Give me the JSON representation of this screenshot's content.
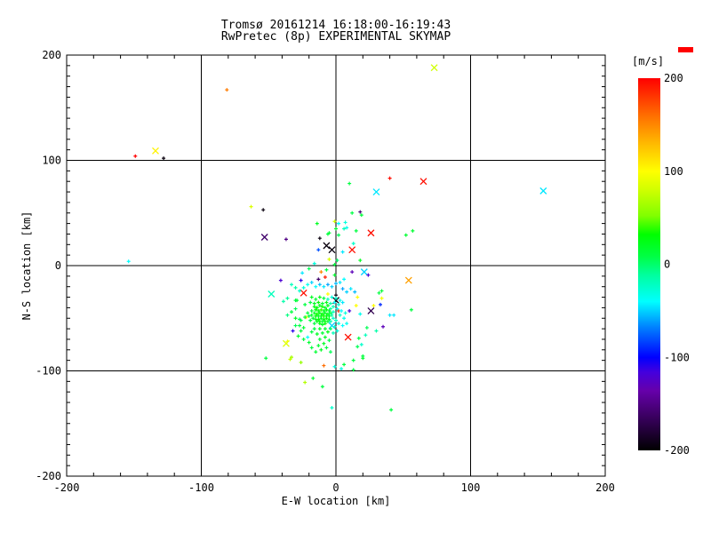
{
  "title": {
    "line1": "Tromsø 20161214 16:18:00-16:19:43",
    "line2": "RwPretec (8p) EXPERIMENTAL SKYMAP"
  },
  "colorbar": {
    "label": "[m/s]",
    "ticks": [
      200,
      100,
      0,
      -100,
      -200
    ],
    "min": -200,
    "max": 200,
    "stops": [
      [
        0.0,
        "#000000"
      ],
      [
        0.1,
        "#40006a"
      ],
      [
        0.16,
        "#6600aa"
      ],
      [
        0.21,
        "#4400dd"
      ],
      [
        0.25,
        "#0000ff"
      ],
      [
        0.33,
        "#0080ff"
      ],
      [
        0.4,
        "#00ffff"
      ],
      [
        0.47,
        "#00ffa0"
      ],
      [
        0.52,
        "#00ff46"
      ],
      [
        0.58,
        "#00ff00"
      ],
      [
        0.63,
        "#80ff00"
      ],
      [
        0.7,
        "#d0ff00"
      ],
      [
        0.75,
        "#ffff00"
      ],
      [
        0.83,
        "#ffb400"
      ],
      [
        0.9,
        "#ff6e00"
      ],
      [
        1.0,
        "#ff0000"
      ]
    ]
  },
  "chart_data": {
    "type": "scatter",
    "xlabel": "E-W location [km]",
    "ylabel": "N-S location [km]",
    "xlim": [
      -200,
      200
    ],
    "ylim": [
      -200,
      200
    ],
    "grid": true,
    "axes": {
      "x": {
        "major_ticks": [
          -200,
          -100,
          0,
          100,
          200
        ],
        "minor_step": 20,
        "gridlines": [
          -100,
          0,
          100
        ]
      },
      "y": {
        "major_ticks": [
          -200,
          -100,
          0,
          100,
          200
        ],
        "minor_step": 10,
        "gridlines": [
          -100,
          0,
          100
        ]
      }
    },
    "value_label": "[m/s]",
    "symbols": {
      "d": "small-plus",
      "x": "cross"
    },
    "points": [
      [
        -81,
        167,
        155,
        "d"
      ],
      [
        73,
        188,
        80,
        "x"
      ],
      [
        -149,
        104,
        200,
        "d"
      ],
      [
        -134,
        109,
        105,
        "x"
      ],
      [
        -128,
        102,
        -195,
        "d"
      ],
      [
        -154,
        4,
        -40,
        "d"
      ],
      [
        154,
        71,
        -45,
        "x"
      ],
      [
        65,
        80,
        195,
        "x"
      ],
      [
        30,
        70,
        -45,
        "x"
      ],
      [
        40,
        83,
        195,
        "d"
      ],
      [
        10,
        78,
        10,
        "d"
      ],
      [
        -63,
        56,
        85,
        "d"
      ],
      [
        -54,
        53,
        -195,
        "d"
      ],
      [
        -53,
        27,
        -160,
        "x"
      ],
      [
        -37,
        25,
        -150,
        "d"
      ],
      [
        26,
        31,
        195,
        "x"
      ],
      [
        52,
        29,
        15,
        "d"
      ],
      [
        57,
        33,
        15,
        "d"
      ],
      [
        12,
        50,
        8,
        "d"
      ],
      [
        18,
        51,
        -155,
        "d"
      ],
      [
        19,
        48,
        12,
        "d"
      ],
      [
        -1,
        42,
        80,
        "d"
      ],
      [
        2,
        40,
        -40,
        "d"
      ],
      [
        7,
        41,
        -30,
        "d"
      ],
      [
        8,
        36,
        -35,
        "d"
      ],
      [
        0,
        35,
        15,
        "d"
      ],
      [
        -14,
        40,
        20,
        "d"
      ],
      [
        -6,
        30,
        10,
        "d"
      ],
      [
        2,
        29,
        5,
        "d"
      ],
      [
        15,
        33,
        10,
        "d"
      ],
      [
        13,
        21,
        -25,
        "d"
      ],
      [
        5,
        13,
        -45,
        "d"
      ],
      [
        -13,
        15,
        -80,
        "d"
      ],
      [
        -5,
        6,
        85,
        "d"
      ],
      [
        1,
        5,
        0,
        "d"
      ],
      [
        -1,
        1,
        10,
        "d"
      ],
      [
        18,
        5,
        20,
        "d"
      ],
      [
        12,
        15,
        195,
        "x"
      ],
      [
        -7,
        19,
        -195,
        "x"
      ],
      [
        -3,
        15,
        -195,
        "x"
      ],
      [
        -12,
        26,
        -195,
        "d"
      ],
      [
        -16,
        2,
        -30,
        "d"
      ],
      [
        -25,
        -7,
        -45,
        "d"
      ],
      [
        6,
        35,
        -20,
        "d"
      ],
      [
        -5,
        31,
        12,
        "d"
      ],
      [
        -11,
        -6,
        150,
        "d"
      ],
      [
        -8,
        -11,
        190,
        "d"
      ],
      [
        -7,
        -4,
        10,
        "d"
      ],
      [
        -1,
        -9,
        15,
        "d"
      ],
      [
        12,
        -6,
        -130,
        "d"
      ],
      [
        6,
        -13,
        -40,
        "d"
      ],
      [
        -13,
        -13,
        -160,
        "d"
      ],
      [
        21,
        -6,
        -50,
        "x"
      ],
      [
        24,
        -9,
        -120,
        "d"
      ],
      [
        -20,
        -3,
        5,
        "d"
      ],
      [
        -41,
        -14,
        -120,
        "d"
      ],
      [
        -26,
        -14,
        -110,
        "d"
      ],
      [
        -24,
        -26,
        195,
        "x"
      ],
      [
        -48,
        -27,
        -20,
        "x"
      ],
      [
        0,
        -33,
        -195,
        "x"
      ],
      [
        0,
        -28,
        -195,
        "d"
      ],
      [
        26,
        -43,
        -170,
        "x"
      ],
      [
        9,
        -68,
        195,
        "x"
      ],
      [
        -37,
        -74,
        85,
        "x"
      ],
      [
        -3,
        -57,
        -50,
        "x"
      ],
      [
        54,
        -14,
        140,
        "x"
      ],
      [
        16,
        -30,
        100,
        "d"
      ],
      [
        15,
        -38,
        100,
        "d"
      ],
      [
        28,
        -38,
        100,
        "d"
      ],
      [
        34,
        -31,
        95,
        "d"
      ],
      [
        -6,
        -27,
        100,
        "d"
      ],
      [
        -22,
        -49,
        95,
        "d"
      ],
      [
        2,
        -43,
        185,
        "d"
      ],
      [
        10,
        -43,
        -120,
        "d"
      ],
      [
        32,
        -26,
        10,
        "d"
      ],
      [
        34,
        -24,
        12,
        "d"
      ],
      [
        40,
        -47,
        -45,
        "d"
      ],
      [
        43,
        -47,
        -45,
        "d"
      ],
      [
        56,
        -42,
        10,
        "d"
      ],
      [
        18,
        -46,
        -35,
        "d"
      ],
      [
        30,
        -62,
        -15,
        "d"
      ],
      [
        23,
        -59,
        5,
        "d"
      ],
      [
        22,
        -66,
        -20,
        "d"
      ],
      [
        17,
        -69,
        10,
        "d"
      ],
      [
        19,
        -75,
        -25,
        "d"
      ],
      [
        16,
        -77,
        5,
        "d"
      ],
      [
        20,
        -86,
        10,
        "d"
      ],
      [
        35,
        -58,
        -130,
        "d"
      ],
      [
        33,
        -37,
        -90,
        "d"
      ],
      [
        -29,
        -33,
        15,
        "d"
      ],
      [
        -23,
        -37,
        10,
        "d"
      ],
      [
        -21,
        -45,
        12,
        "d"
      ],
      [
        -26,
        -52,
        8,
        "d"
      ],
      [
        -23,
        -49,
        15,
        "d"
      ],
      [
        -26,
        -62,
        10,
        "d"
      ],
      [
        -32,
        -62,
        -110,
        "d"
      ],
      [
        -21,
        -68,
        -40,
        "d"
      ],
      [
        -30,
        -50,
        18,
        "d"
      ],
      [
        -27,
        -51,
        5,
        "d"
      ],
      [
        -30,
        -33,
        10,
        "d"
      ],
      [
        -36,
        -72,
        95,
        "d"
      ],
      [
        -52,
        -88,
        10,
        "d"
      ],
      [
        -33,
        -87,
        65,
        "d"
      ],
      [
        -26,
        -92,
        60,
        "d"
      ],
      [
        -34,
        -89,
        75,
        "d"
      ],
      [
        -23,
        -111,
        70,
        "d"
      ],
      [
        -17,
        -107,
        15,
        "d"
      ],
      [
        -10,
        -115,
        10,
        "d"
      ],
      [
        -3,
        -135,
        -25,
        "d"
      ],
      [
        41,
        -137,
        10,
        "d"
      ],
      [
        -9,
        -95,
        160,
        "d"
      ],
      [
        -1,
        -96,
        -30,
        "d"
      ],
      [
        4,
        -98,
        -30,
        "d"
      ],
      [
        6,
        -94,
        10,
        "d"
      ],
      [
        13,
        -90,
        10,
        "d"
      ],
      [
        20,
        -88,
        15,
        "d"
      ],
      [
        13,
        -99,
        8,
        "d"
      ],
      [
        -16,
        -39,
        25,
        "d"
      ],
      [
        -14,
        -40,
        30,
        "d"
      ],
      [
        -12,
        -38,
        20,
        "d"
      ],
      [
        -10,
        -39,
        35,
        "d"
      ],
      [
        -8,
        -40,
        15,
        "d"
      ],
      [
        -6,
        -38,
        25,
        "d"
      ],
      [
        -15,
        -42,
        30,
        "d"
      ],
      [
        -13,
        -43,
        25,
        "d"
      ],
      [
        -11,
        -42,
        40,
        "d"
      ],
      [
        -9,
        -43,
        20,
        "d"
      ],
      [
        -7,
        -42,
        30,
        "d"
      ],
      [
        -5,
        -43,
        15,
        "d"
      ],
      [
        -16,
        -45,
        20,
        "d"
      ],
      [
        -14,
        -46,
        35,
        "d"
      ],
      [
        -12,
        -45,
        25,
        "d"
      ],
      [
        -10,
        -46,
        30,
        "d"
      ],
      [
        -8,
        -45,
        20,
        "d"
      ],
      [
        -6,
        -46,
        25,
        "d"
      ],
      [
        -4,
        -45,
        10,
        "d"
      ],
      [
        -15,
        -48,
        30,
        "d"
      ],
      [
        -13,
        -48,
        20,
        "d"
      ],
      [
        -11,
        -48,
        25,
        "d"
      ],
      [
        -9,
        -48,
        35,
        "d"
      ],
      [
        -7,
        -48,
        25,
        "d"
      ],
      [
        -5,
        -48,
        20,
        "d"
      ],
      [
        -17,
        -50,
        15,
        "d"
      ],
      [
        -15,
        -51,
        25,
        "d"
      ],
      [
        -13,
        -51,
        30,
        "d"
      ],
      [
        -11,
        -50,
        20,
        "d"
      ],
      [
        -9,
        -51,
        25,
        "d"
      ],
      [
        -7,
        -50,
        30,
        "d"
      ],
      [
        -5,
        -51,
        20,
        "d"
      ],
      [
        -14,
        -53,
        25,
        "d"
      ],
      [
        -12,
        -53,
        30,
        "d"
      ],
      [
        -10,
        -53,
        15,
        "d"
      ],
      [
        -8,
        -53,
        25,
        "d"
      ],
      [
        -6,
        -53,
        20,
        "d"
      ],
      [
        -16,
        -55,
        10,
        "d"
      ],
      [
        -12,
        -55,
        25,
        "d"
      ],
      [
        -10,
        -56,
        20,
        "d"
      ],
      [
        -8,
        -55,
        30,
        "d"
      ],
      [
        -18,
        -43,
        15,
        "d"
      ],
      [
        -18,
        -47,
        20,
        "d"
      ],
      [
        -3,
        -47,
        -15,
        "d"
      ],
      [
        -2,
        -44,
        -20,
        "d"
      ],
      [
        -4,
        -41,
        -10,
        "d"
      ],
      [
        -2,
        -50,
        -25,
        "d"
      ],
      [
        -4,
        -53,
        -15,
        "d"
      ],
      [
        -19,
        -52,
        10,
        "d"
      ],
      [
        -20,
        -48,
        5,
        "d"
      ],
      [
        -18,
        -30,
        20,
        "d"
      ],
      [
        -15,
        -32,
        15,
        "d"
      ],
      [
        -12,
        -30,
        25,
        "d"
      ],
      [
        -9,
        -31,
        10,
        "d"
      ],
      [
        -6,
        -32,
        -20,
        "d"
      ],
      [
        -3,
        -30,
        -30,
        "d"
      ],
      [
        0,
        -31,
        -25,
        "d"
      ],
      [
        3,
        -33,
        -35,
        "d"
      ],
      [
        -19,
        -35,
        10,
        "d"
      ],
      [
        -16,
        -36,
        20,
        "d"
      ],
      [
        -13,
        -35,
        30,
        "d"
      ],
      [
        -10,
        -36,
        15,
        "d"
      ],
      [
        -7,
        -35,
        25,
        "d"
      ],
      [
        -4,
        -36,
        -15,
        "d"
      ],
      [
        -1,
        -35,
        -40,
        "d"
      ],
      [
        2,
        -37,
        -30,
        "d"
      ],
      [
        5,
        -35,
        -45,
        "d"
      ],
      [
        -2,
        -39,
        -20,
        "d"
      ],
      [
        1,
        -41,
        -35,
        "d"
      ],
      [
        4,
        -43,
        -40,
        "d"
      ],
      [
        7,
        -45,
        -30,
        "d"
      ],
      [
        3,
        -47,
        -25,
        "d"
      ],
      [
        6,
        -50,
        -35,
        "d"
      ],
      [
        0,
        -52,
        -20,
        "d"
      ],
      [
        2,
        -55,
        -30,
        "d"
      ],
      [
        -1,
        -58,
        -25,
        "d"
      ],
      [
        5,
        -57,
        -40,
        "d"
      ],
      [
        8,
        -55,
        -35,
        "d"
      ],
      [
        -4,
        -60,
        5,
        "d"
      ],
      [
        -8,
        -60,
        15,
        "d"
      ],
      [
        -12,
        -60,
        20,
        "d"
      ],
      [
        -16,
        -60,
        10,
        "d"
      ],
      [
        -6,
        -63,
        25,
        "d"
      ],
      [
        -10,
        -64,
        15,
        "d"
      ],
      [
        -2,
        -64,
        -20,
        "d"
      ],
      [
        1,
        -62,
        -30,
        "d"
      ],
      [
        -14,
        -65,
        20,
        "d"
      ],
      [
        -18,
        -63,
        10,
        "d"
      ],
      [
        -8,
        -68,
        20,
        "d"
      ],
      [
        -12,
        -70,
        15,
        "d"
      ],
      [
        -5,
        -71,
        10,
        "d"
      ],
      [
        -9,
        -74,
        20,
        "d"
      ],
      [
        -13,
        -76,
        15,
        "d"
      ],
      [
        -7,
        -78,
        10,
        "d"
      ],
      [
        -11,
        -80,
        20,
        "d"
      ],
      [
        -15,
        -82,
        15,
        "d"
      ],
      [
        -4,
        -82,
        5,
        "d"
      ],
      [
        -18,
        -78,
        10,
        "d"
      ],
      [
        -20,
        -73,
        15,
        "d"
      ],
      [
        -24,
        -70,
        10,
        "d"
      ],
      [
        -28,
        -67,
        15,
        "d"
      ],
      [
        -3,
        -20,
        -50,
        "d"
      ],
      [
        -6,
        -18,
        -60,
        "d"
      ],
      [
        -9,
        -20,
        -45,
        "d"
      ],
      [
        -12,
        -18,
        -55,
        "d"
      ],
      [
        -15,
        -20,
        -40,
        "d"
      ],
      [
        -18,
        -16,
        -50,
        "d"
      ],
      [
        -21,
        -18,
        -35,
        "d"
      ],
      [
        0,
        -17,
        -55,
        "d"
      ],
      [
        3,
        -16,
        -45,
        "d"
      ],
      [
        -24,
        -21,
        -30,
        "d"
      ],
      [
        -27,
        -24,
        -25,
        "d"
      ],
      [
        -30,
        -21,
        -15,
        "d"
      ],
      [
        -33,
        -18,
        -20,
        "d"
      ],
      [
        5,
        -22,
        -60,
        "d"
      ],
      [
        8,
        -25,
        -50,
        "d"
      ],
      [
        11,
        -22,
        -45,
        "d"
      ],
      [
        14,
        -25,
        -55,
        "d"
      ],
      [
        -36,
        -31,
        -10,
        "d"
      ],
      [
        -39,
        -34,
        -15,
        "d"
      ],
      [
        -30,
        -41,
        5,
        "d"
      ],
      [
        -33,
        -44,
        10,
        "d"
      ],
      [
        -36,
        -47,
        -5,
        "d"
      ],
      [
        -27,
        -57,
        10,
        "d"
      ],
      [
        -30,
        -57,
        5,
        "d"
      ],
      [
        -24,
        -59,
        15,
        "d"
      ]
    ]
  }
}
